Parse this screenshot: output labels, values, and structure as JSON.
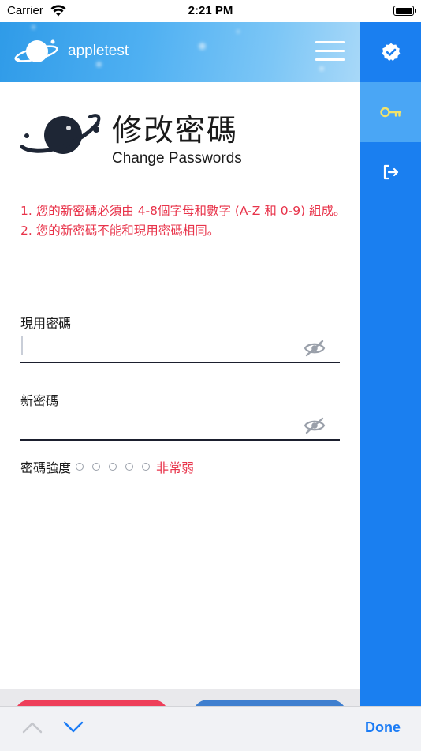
{
  "status_bar": {
    "carrier": "Carrier",
    "time": "2:21 PM"
  },
  "header": {
    "title": "appletest",
    "menu_icon": "hamburger-menu-icon"
  },
  "sidebar": {
    "items": [
      {
        "icon": "verified-badge-icon",
        "active": false
      },
      {
        "icon": "key-icon",
        "active": true
      },
      {
        "icon": "logout-icon",
        "active": false
      }
    ]
  },
  "page": {
    "title": "修改密碼",
    "subtitle": "Change Passwords"
  },
  "notes": [
    "1. 您的新密碼必須由 4-8個字母和數字 (A-Z 和 0-9) 組成。",
    "2. 您的新密碼不能和現用密碼相同。"
  ],
  "form": {
    "current_password": {
      "label": "現用密碼",
      "value": "",
      "placeholder": ""
    },
    "new_password": {
      "label": "新密碼",
      "value": "",
      "placeholder": ""
    }
  },
  "strength": {
    "label": "密碼強度",
    "filled": 0,
    "total": 5,
    "level_text": "非常弱"
  },
  "keyboard_toolbar": {
    "done_label": "Done"
  },
  "colors": {
    "accent": "#1a7ff0",
    "warning": "#e8334a",
    "key_icon": "#f2e36b",
    "done": "#1b7cf5"
  }
}
